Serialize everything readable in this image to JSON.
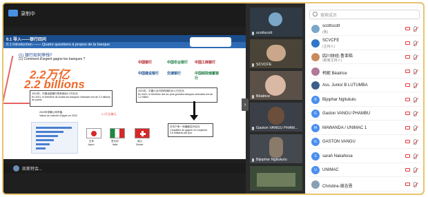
{
  "meeting": {
    "status_text": "录制中"
  },
  "slide": {
    "header_cn": "0.1 导入——银行四问",
    "header_fr": "0.1 Introduction —— Quatre questions à propos de la banque",
    "question_cn": "(1) 银行如何挣钱?",
    "question_fr": "(1) Comment d'argent gagne les banques ?",
    "big_number_cn": "2.2万亿",
    "big_number_fr": "2.2 billions",
    "box1_cn": "2021年，中国全部银行的利润为2.2万亿元",
    "box1_fr": "En 2021, le bénéfice de toutes les banques chinoises est de 2,2 billions de yuans",
    "box2_cn": "2021年，中国六大行的利润约为1.2万亿元",
    "box2_fr": "En 2021, le bénéfice des six plus grandes banques chinoises est de 1,2 billion",
    "box3_cn": "2022年苹果公司市值",
    "box3_fr": "Valeur du marché d'Apple en 2022",
    "box4_cn": "平均下来一天赚超过25亿元",
    "box4_fr": "L'équilibre de gagner en moyenne 2,5 milliards par jour",
    "apple_label": "2.2万亿美元",
    "flags": [
      {
        "cn": "日本",
        "fr": "Japon"
      },
      {
        "cn": "意大利",
        "fr": "Italie"
      },
      {
        "cn": "瑞士",
        "fr": "Suisse"
      }
    ],
    "banks": [
      "中国银行",
      "中国农业银行",
      "中国工商银行",
      "中国建设银行",
      "交通银行",
      "中国邮政储蓄银行"
    ]
  },
  "bottom": {
    "presenter": "凯斯特会..."
  },
  "tiles": [
    {
      "name": "scottscott",
      "muted": false
    },
    {
      "name": "SCVCFE",
      "muted": true
    },
    {
      "name": "Béatrice",
      "muted": false
    },
    {
      "name": "Gaston VANGU PHAM...",
      "muted": true
    },
    {
      "name": "Bijophar Ngitukulu",
      "muted": true
    },
    {
      "name": "",
      "muted": false
    }
  ],
  "participants": {
    "search_placeholder": "搜索成员",
    "items": [
      {
        "name": "scottscott",
        "sub": "(我)",
        "avatar": "",
        "avatar_color": "#7aa7c7"
      },
      {
        "name": "SCVCFE",
        "sub": "(主持人)",
        "avatar": "",
        "avatar_color": "#2f77c8"
      },
      {
        "name": "四川财经-鲁亚皓",
        "sub": "(联席主持人)",
        "avatar": "",
        "avatar_color": "#c98a5e"
      },
      {
        "name": "柯妮 Béatrice",
        "sub": "",
        "avatar": "",
        "avatar_color": "#b07a9b"
      },
      {
        "name": "Ass. Junior B LUTUMBA",
        "sub": "",
        "avatar": "",
        "avatar_color": "#3b5f8a"
      },
      {
        "name": "Bijophar Ngitukulu",
        "sub": "",
        "avatar": "B",
        "avatar_color": "#4a8ff0"
      },
      {
        "name": "Gaston VANGU PHAMBU",
        "sub": "",
        "avatar": "G",
        "avatar_color": "#4a8ff0"
      },
      {
        "name": "MAWANDA / UNIMAC 1",
        "sub": "",
        "avatar": "M",
        "avatar_color": "#4a8ff0"
      },
      {
        "name": "GASTON VANGU",
        "sub": "",
        "avatar": "G",
        "avatar_color": "#4a8ff0"
      },
      {
        "name": "sarah Nakahosa",
        "sub": "",
        "avatar": "S",
        "avatar_color": "#4a8ff0"
      },
      {
        "name": "UNIMAC",
        "sub": "",
        "avatar": "U",
        "avatar_color": "#4a8ff0"
      },
      {
        "name": "Christine-谢吉恩",
        "sub": "",
        "avatar": "",
        "avatar_color": "#8aa0b3"
      }
    ]
  }
}
